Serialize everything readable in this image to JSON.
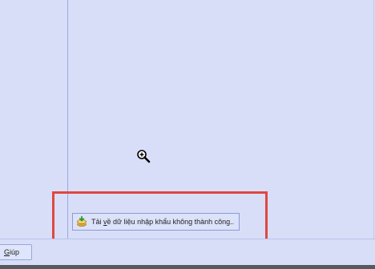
{
  "status_message": {
    "prefix": "Tải ",
    "underlined": "v",
    "middle": "ề dữ liệu nhập khẩu không thành công.."
  },
  "footer": {
    "help_mnemonic": "G",
    "help_rest": "iúp"
  },
  "icons": {
    "toast_icon": "download-database-icon",
    "cursor": "zoom-in-cursor-icon"
  },
  "colors": {
    "background": "#d8def8",
    "highlight_border": "#e0473f",
    "toast_background": "#dce2fa",
    "divider": "#9aa8e6"
  }
}
